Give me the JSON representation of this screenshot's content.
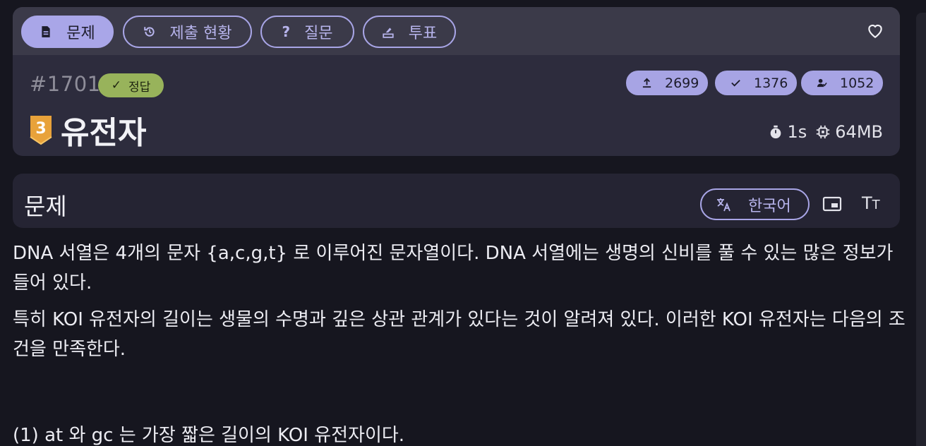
{
  "tabs": [
    {
      "label": "문제",
      "icon": "document-icon",
      "active": true
    },
    {
      "label": "제출 현황",
      "icon": "history-icon",
      "active": false
    },
    {
      "label": "질문",
      "icon": "question-icon",
      "active": false
    },
    {
      "label": "투표",
      "icon": "vote-icon",
      "active": false
    }
  ],
  "problem": {
    "id": "#1701",
    "status": "정답",
    "tier": "3",
    "title": "유전자",
    "stats": {
      "submissions": "2699",
      "accepted": "1376",
      "solvers": "1052"
    },
    "time_limit": "1s",
    "memory_limit": "64MB"
  },
  "section": {
    "title": "문제",
    "language": "한국어"
  },
  "body": {
    "p1": "DNA 서열은 4개의 문자 {a,c,g,t} 로 이루어진 문자열이다. DNA 서열에는 생명의 신비를 풀 수 있는 많은 정보가 들어 있다.",
    "p2": "특히 KOI 유전자의 길이는 생물의 수명과 깊은 상관 관계가 있다는 것이 알려져 있다. 이러한 KOI 유전자는 다음의 조건을 만족한다.",
    "p3": "(1) at 와 gc 는 가장 짧은 길이의 KOI 유전자이다."
  },
  "colors": {
    "accent": "#a9a6e8",
    "success": "#98b35b",
    "tier_bronze": "#e8a23a",
    "background": "#16161f"
  }
}
